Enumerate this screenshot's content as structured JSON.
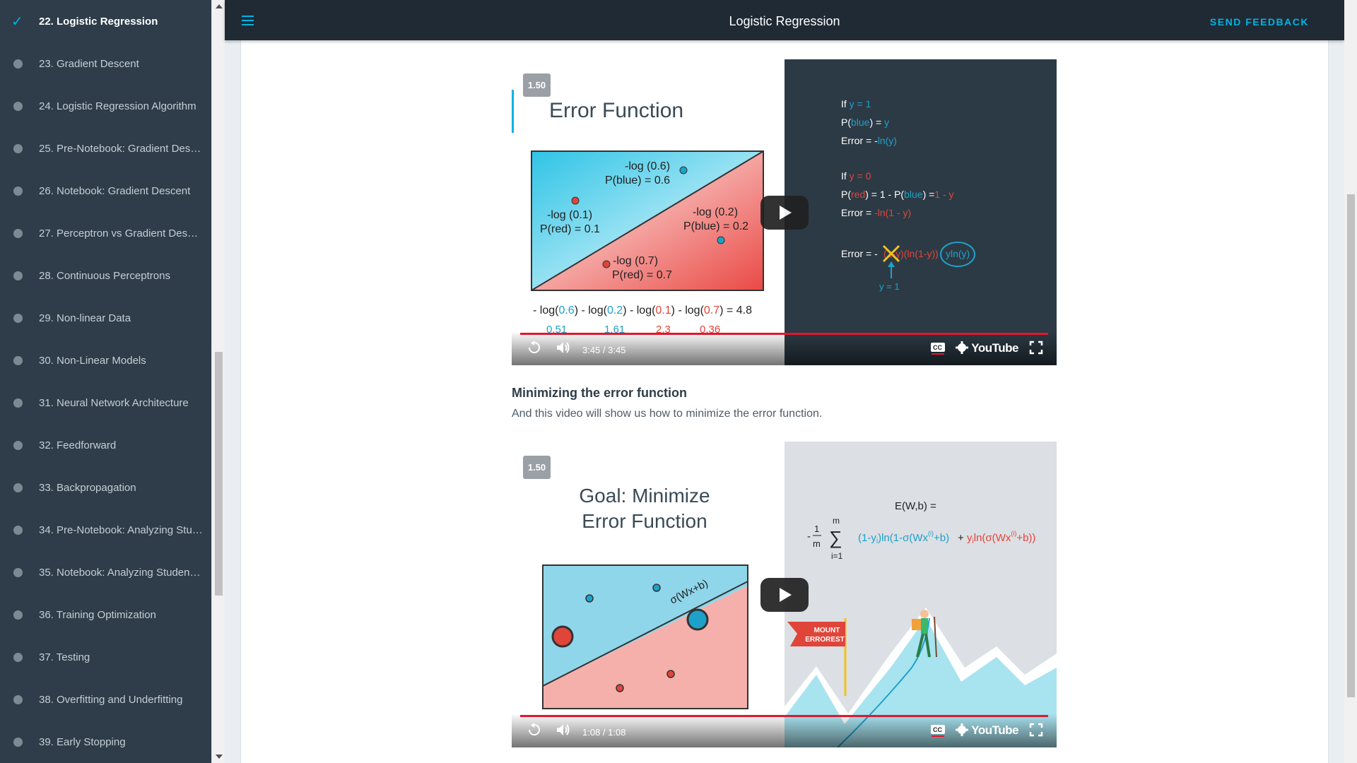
{
  "sidebar": {
    "items": [
      {
        "label": "22. Logistic Regression",
        "active": true
      },
      {
        "label": "23. Gradient Descent"
      },
      {
        "label": "24. Logistic Regression Algorithm"
      },
      {
        "label": "25. Pre-Notebook: Gradient Desc..."
      },
      {
        "label": "26. Notebook: Gradient Descent"
      },
      {
        "label": "27. Perceptron vs Gradient Desce..."
      },
      {
        "label": "28. Continuous Perceptrons"
      },
      {
        "label": "29. Non-linear Data"
      },
      {
        "label": "30. Non-Linear Models"
      },
      {
        "label": "31. Neural Network Architecture"
      },
      {
        "label": "32. Feedforward"
      },
      {
        "label": "33. Backpropagation"
      },
      {
        "label": "34. Pre-Notebook: Analyzing Stud..."
      },
      {
        "label": "35. Notebook: Analyzing Student ..."
      },
      {
        "label": "36. Training Optimization"
      },
      {
        "label": "37. Testing"
      },
      {
        "label": "38. Overfitting and Underfitting"
      },
      {
        "label": "39. Early Stopping"
      }
    ]
  },
  "header": {
    "title": "Logistic Regression",
    "feedback_label": "SEND FEEDBACK",
    "menu_icon": "hamburger-icon"
  },
  "video1": {
    "speed": "1.50",
    "time": "3:45 / 3:45",
    "youtube_label": "YouTube",
    "slide_title": "Error Function",
    "labels": {
      "l1a": "-log (0.6)",
      "l1b": "P(blue) = 0.6",
      "l2a": "-log (0.1)",
      "l2b": "P(red) = 0.1",
      "l3a": "-log (0.2)",
      "l3b": "P(blue) = 0.2",
      "l4a": "-log (0.7)",
      "l4b": "P(red) = 0.7"
    },
    "sum_parts": [
      "- log(",
      "0.6",
      ") - log(",
      "0.2",
      ") - log(",
      "0.1",
      ") - log(",
      "0.7",
      ") = 4.8"
    ],
    "values": [
      "0.51",
      "1.61",
      "2.3",
      "0.36"
    ],
    "formulas": {
      "if1": "If",
      "y1": "y = 1",
      "pblue_a": "P(",
      "pblue_b": "blue",
      "pblue_c": ") = ",
      "pblue_d": "y",
      "err1_a": "Error = -",
      "err1_b": "ln(y)",
      "if0": "If",
      "y0": "y = 0",
      "pred_a": "P(",
      "pred_b": "red",
      "pred_c": ") = 1 - P(",
      "pred_d": "blue",
      "pred_e": ") =",
      "pred_f": "1 - y",
      "err0_a": "Error = ",
      "err0_b": "-ln(1 - y)",
      "errf_a": "Error = - ",
      "errf_b": "(1-y)(ln(1-y))",
      "errf_c": "yln(y)",
      "yeq1": "y = 1"
    }
  },
  "section": {
    "heading": "Minimizing the error function",
    "text": "And this video will show us how to minimize the error function."
  },
  "video2": {
    "speed": "1.50",
    "time": "1:08 / 1:08",
    "youtube_label": "YouTube",
    "slide_title_1": "Goal: Minimize",
    "slide_title_2": "Error Function",
    "line_label": "σ(Wx+b)",
    "formula_top": "E(W,b) =",
    "sum_m": "m",
    "sum_i": "i=1",
    "frac_top": "1",
    "frac_bot": "m",
    "neg": "-",
    "sigma": "∑",
    "term1": "(1-y",
    "term1_sub": "i",
    "term1_b": ")ln(1-σ(Wx",
    "term1_sup": "(i)",
    "term1_c": "+b)",
    "plus": "+",
    "term2": "y",
    "term2_sub": "i",
    "term2_b": "ln(σ(Wx",
    "term2_sup": "(i)",
    "term2_c": "+b))",
    "flag_line1": "MOUNT",
    "flag_line2": "ERROREST"
  },
  "colors": {
    "accent": "#02b3e4",
    "sidebar_bg": "#2e3d49",
    "header_bg": "#1f2a35",
    "blue_text": "#1ea1c9",
    "red_text": "#e0453a",
    "slide_dark": "#2c3a45",
    "progress": "#e3172d"
  }
}
